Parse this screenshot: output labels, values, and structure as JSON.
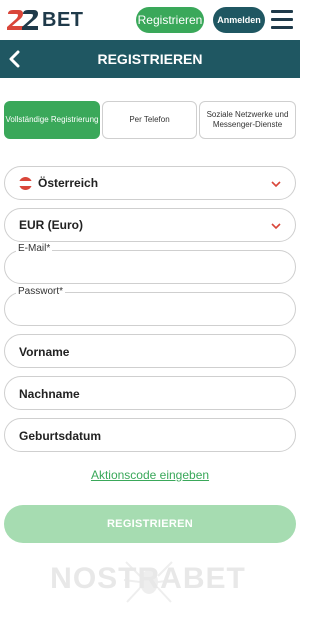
{
  "header": {
    "logo_text": "BET",
    "register_label": "Registrieren",
    "login_label": "Anmelden"
  },
  "titlebar": {
    "title": "REGISTRIEREN"
  },
  "tabs": [
    {
      "label": "Vollständige Registrierung",
      "active": true
    },
    {
      "label": "Per Telefon",
      "active": false
    },
    {
      "label": "Soziale Netzwerke und Messenger-Dienste",
      "active": false
    }
  ],
  "form": {
    "country": "Österreich",
    "currency": "EUR (Euro)",
    "email_label": "E-Mail",
    "password_label": "Passwort",
    "required_mark": "*",
    "first_name": "Vorname",
    "last_name": "Nachname",
    "birthdate": "Geburtsdatum",
    "promo_link": "Aktionscode eingeben",
    "submit_label": "REGISTRIEREN"
  },
  "watermark": {
    "text": "NOSTRABET"
  },
  "colors": {
    "brand_green": "#3aa85a",
    "header_teal": "#1f5762",
    "submit_disabled": "#a6dcb1",
    "chevron_red": "#d9463a"
  }
}
